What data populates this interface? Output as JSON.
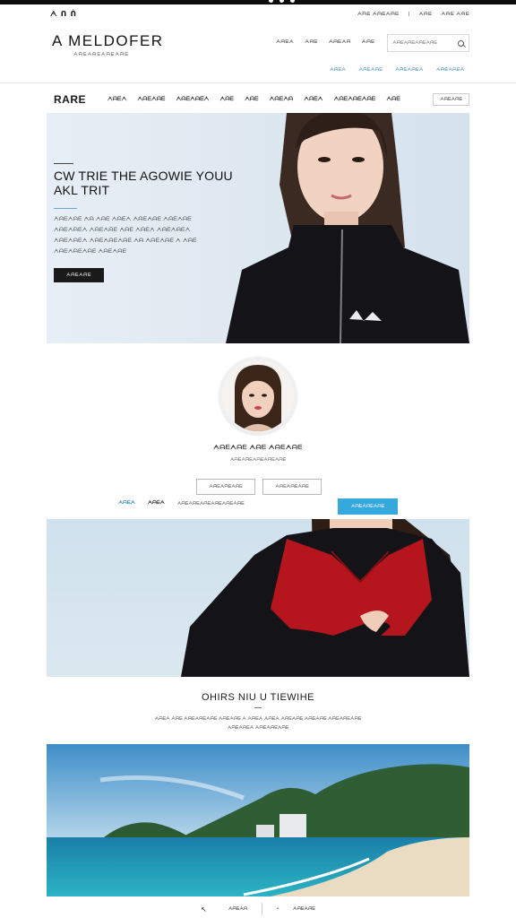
{
  "util": {
    "left": "ᗅ ᑎ ᑏ",
    "right": [
      "ᗅᗩᗴ ᗅᗩᗴᗅᗩᗴ",
      "|",
      "ᗅᗩᗴ",
      "ᗅᗩᗴ ᗅᗩᗴ"
    ]
  },
  "brand": "A MELDOFER",
  "tagline": "ᗅᗩᗴᗅᗩᗴᗅᗩᗴᗅᗩᗴ",
  "headnav": [
    "ᗅᗩᗴᗅ",
    "ᗅᗩᗴ",
    "ᗅᗩᗴᗅᗩ",
    "ᗅᗩᗴ"
  ],
  "search": {
    "placeholder": "ᗅᗩᗴᗅᗩᗴᗅᗩᗴᗅᗩᗴ"
  },
  "sublinks": [
    "ᗅᗩᗴᗅ",
    "ᗅᗩᗴᗅᗩᗴ",
    "ᗅᗩᗴᗅᗩᗴᗅ",
    "ᗅᗩᗴᗅᗩᗴᗅ"
  ],
  "mainnav": {
    "logo": "RARE",
    "items": [
      "ᗅᗩᗴᗅ",
      "ᗅᗩᗴᗅᗩᗴ",
      "ᗅᗩᗴᗅᗩᗴᗅ",
      "ᗅᗩᗴ",
      "ᗅᗩᗴ",
      "ᗅᗩᗴᗅᗩ",
      "ᗅᗩᗴᗅ",
      "ᗅᗩᗴᗅᗩᗴᗅᗩᗴ",
      "ᗅᗩᗴ"
    ],
    "button": "ᗅᗩᗴᗅᗩᗴ"
  },
  "hero": {
    "title_line1": "CW TRIE THE AGOWIE YOUU",
    "title_line2": "AKL TRIT",
    "body": "ᗅᗩᗴᗅᗩᗴ ᗅᗩ ᗅᗩᗴ ᗅᗩᗴᗅ ᗅᗩᗴᗅᗩᗴ ᗅᗩᗴᗅᗩᗴ ᗅᗩᗴᗅᗩᗴᗅ ᗅᗩᗴᗅᗩᗴ ᗅᗩᗴ ᗅᗩᗴᗅ ᗅᗩᗴᗅᗩᗴᗅ ᗅᗩᗴᗅᗩᗴᗅ ᗅᗩᗴᗅᗩᗴᗅᗩᗴ ᗅᗩ ᗅᗩᗴᗅᗩᗴ ᗅ ᗅᗩᗴ ᗅᗩᗴᗅᗩᗴᗅᗩᗴ ᗅᗩᗴᗅᗩᗴ",
    "cta": "ᗅᗩᗴᗅᗩᗴ"
  },
  "profile": {
    "name": "ᗅᗩᗴᗅᗩᗴ ᗅᗩᗴ ᗅᗩᗴᗅᗩᗴ",
    "sub": "ᗅᗩᗴᗅᗩᗴᗅᗩᗴᗅᗩᗴᗅᗩᗴ",
    "buttons": [
      "ᗅᗩᗴᗅᗩᗴᗅᗩᗴ",
      "ᗅᗩᗴᗅᗩᗴᗅᗩᗴ"
    ]
  },
  "filters": {
    "f1": "ᗅᗩᗴᗅ",
    "f2": "ᗅᗩᗴᗅ",
    "f3": "ᗅᗩᗴᗅᗩᗴᗅᗩᗴᗅᗩᗴᗅᗩᗴᗅᗩᗴ",
    "button": "ᗅᗩᗴᗅᗩᗴᗅᗩᗴ"
  },
  "section": {
    "title": "OHIRS NIU U TIEWIHE",
    "desc": "ᗅᗩᗴᗅ ᗅᗩᗴ ᗅᗩᗴᗅᗩᗴᗅᗩᗴ ᗅᗩᗴᗅᗩᗴ ᗅ ᗅᗩᗴᗅ ᗅᗩᗴᗅ ᗅᗩᗴᗅᗩᗴ ᗅᗩᗴᗅᗩᗴ ᗅᗩᗴᗅᗩᗴᗅᗩᗴ ᗅᗩᗴᗅᗩᗴᗅ ᗅᗩᗴᗅᗩᗴᗅᗩᗴ"
  },
  "footer": {
    "left": "ᗅᗩᗴᗅᗩ",
    "right": "ᗅᗩᗴᗅᗩᗴ"
  },
  "colors": {
    "accent": "#37a8dc",
    "sweater_red": "#b5151c",
    "jacket_black": "#141418"
  }
}
